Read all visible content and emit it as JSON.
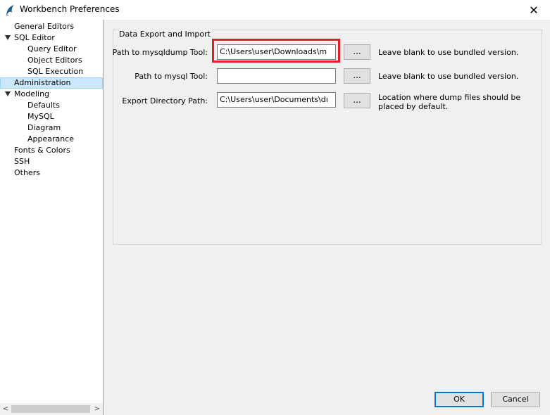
{
  "window": {
    "title": "Workbench Preferences",
    "close_glyph": "✕"
  },
  "sidebar": {
    "items": [
      {
        "label": "General Editors",
        "level": 0,
        "expandable": false,
        "selected": false
      },
      {
        "label": "SQL Editor",
        "level": 0,
        "expandable": true,
        "selected": false
      },
      {
        "label": "Query Editor",
        "level": 1,
        "expandable": false,
        "selected": false
      },
      {
        "label": "Object Editors",
        "level": 1,
        "expandable": false,
        "selected": false
      },
      {
        "label": "SQL Execution",
        "level": 1,
        "expandable": false,
        "selected": false
      },
      {
        "label": "Administration",
        "level": 0,
        "expandable": false,
        "selected": true
      },
      {
        "label": "Modeling",
        "level": 0,
        "expandable": true,
        "selected": false
      },
      {
        "label": "Defaults",
        "level": 1,
        "expandable": false,
        "selected": false
      },
      {
        "label": "MySQL",
        "level": 1,
        "expandable": false,
        "selected": false
      },
      {
        "label": "Diagram",
        "level": 1,
        "expandable": false,
        "selected": false
      },
      {
        "label": "Appearance",
        "level": 1,
        "expandable": false,
        "selected": false
      },
      {
        "label": "Fonts & Colors",
        "level": 0,
        "expandable": false,
        "selected": false
      },
      {
        "label": "SSH",
        "level": 0,
        "expandable": false,
        "selected": false
      },
      {
        "label": "Others",
        "level": 0,
        "expandable": false,
        "selected": false
      }
    ],
    "scroll_left": "<",
    "scroll_right": ">"
  },
  "group": {
    "title": "Data Export and Import",
    "rows": [
      {
        "label": "Path to mysqldump Tool:",
        "value": "C:\\Users\\user\\Downloads\\m",
        "button": "...",
        "hint": "Leave blank to use bundled version."
      },
      {
        "label": "Path to mysql Tool:",
        "value": "",
        "button": "...",
        "hint": "Leave blank to use bundled version."
      },
      {
        "label": "Export Directory Path:",
        "value": "C:\\Users\\user\\Documents\\dı",
        "button": "...",
        "hint": "Location where dump files should be placed by default."
      }
    ]
  },
  "buttons": {
    "ok": "OK",
    "cancel": "Cancel"
  },
  "colors": {
    "highlight": "#e0202a",
    "selection": "#cce8ff",
    "default_button_border": "#0078d7"
  }
}
